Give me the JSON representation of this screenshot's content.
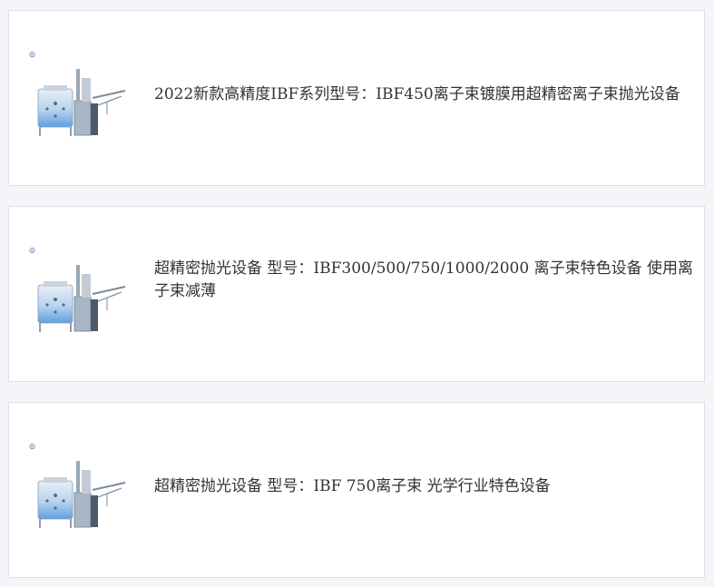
{
  "products": [
    {
      "title": "2022新款高精度IBF系列型号：IBF450离子束镀膜用超精密离子束抛光设备",
      "image_icon": "ion-beam-machine-image",
      "badge_glyph": "◎"
    },
    {
      "title": "超精密抛光设备 型号：IBF300/500/750/1000/2000 离子束特色设备 使用离子束减薄",
      "image_icon": "ion-beam-machine-image",
      "badge_glyph": "◎"
    },
    {
      "title": "超精密抛光设备 型号：IBF 750离子束 光学行业特色设备",
      "image_icon": "ion-beam-machine-image",
      "badge_glyph": "◎"
    }
  ],
  "colors": {
    "page_background": "#f3f5f9",
    "card_background": "#ffffff",
    "card_border": "#dcdfe6",
    "title_text": "#333333",
    "machine_blue": "#6aa6e0"
  }
}
